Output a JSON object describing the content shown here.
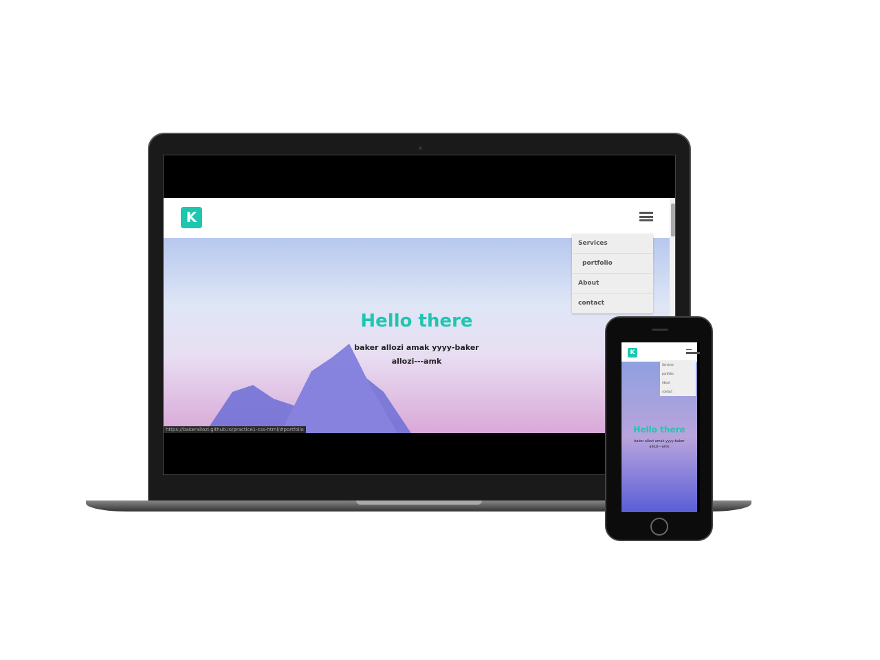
{
  "site": {
    "logo": "K",
    "hero_title": "Hello there",
    "hero_subtitle": "baker allozi amak yyyy-baker allozi---amk",
    "menu": [
      {
        "label": "Services"
      },
      {
        "label": "portfolio"
      },
      {
        "label": "About"
      },
      {
        "label": "contact"
      }
    ],
    "status_url": "https://bakerallozi.github.io/practice1-css-html/#portfolio"
  },
  "colors": {
    "accent": "#1ec6b0"
  }
}
